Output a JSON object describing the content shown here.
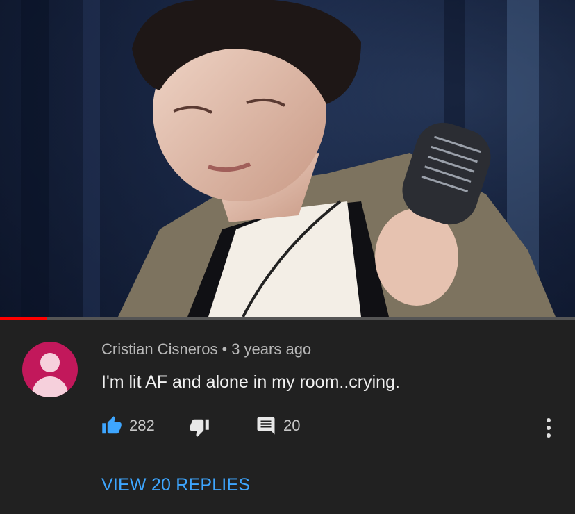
{
  "video": {
    "thumbnail_icon": "performer-with-microphone-image",
    "progress_fraction": 0.082,
    "progress_color": "#ff0000"
  },
  "comment": {
    "avatar_color": "#c2185b",
    "author": "Cristian Cisneros",
    "separator": "•",
    "time": "3 years ago",
    "text": "I'm lit AF and alone in my room..crying.",
    "likes": "282",
    "like_color": "#3ea6ff",
    "replies_count": "20",
    "view_replies_label": "VIEW 20 REPLIES",
    "more_icon": "more-vert-icon"
  }
}
